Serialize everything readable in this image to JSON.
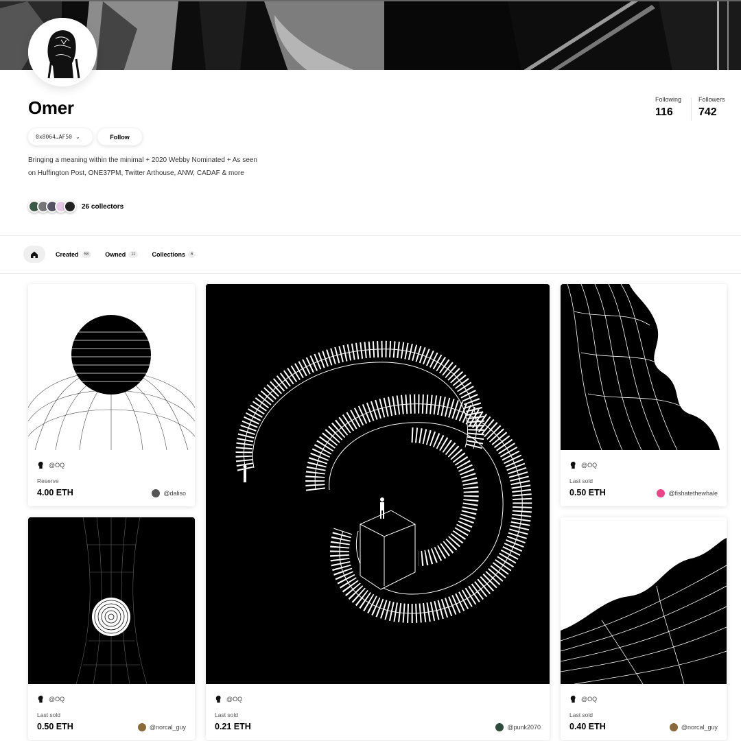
{
  "profile": {
    "name": "Omer",
    "address": "0x8064…AF50",
    "follow_label": "Follow",
    "bio": "Bringing a meaning within the minimal + 2020 Webby Nominated + As seen on Huffington Post, ONE37PM, Twitter Arthouse, ANW, CADAF & more",
    "collectors_label": "26 collectors"
  },
  "stats": {
    "following_label": "Following",
    "following_value": "116",
    "followers_label": "Followers",
    "followers_value": "742"
  },
  "tabs": [
    {
      "label": "Created",
      "count": "58"
    },
    {
      "label": "Owned",
      "count": "11"
    },
    {
      "label": "Collections",
      "count": "6"
    }
  ],
  "cards": [
    {
      "creator": "@OQ",
      "status": "Reserve",
      "price": "4.00 ETH",
      "buyer": "@daliso",
      "buyer_color": "#555555"
    },
    {
      "creator": "@OQ",
      "status": "Last sold",
      "price": "0.21 ETH",
      "buyer": "@punk2070",
      "buyer_color": "#2e4a3a"
    },
    {
      "creator": "@OQ",
      "status": "Last sold",
      "price": "0.50 ETH",
      "buyer": "@fishatethewhale",
      "buyer_color": "#e8458b"
    },
    {
      "creator": "@OQ",
      "status": "Last sold",
      "price": "0.50 ETH",
      "buyer": "@norcal_guy",
      "buyer_color": "#8a6a3a"
    },
    {
      "creator": "@OQ",
      "status": "Last sold",
      "price": "0.40 ETH",
      "buyer": "@norcal_guy",
      "buyer_color": "#8a6a3a"
    }
  ],
  "colors": {
    "accent": "#000000",
    "tab_bg": "#efefef",
    "fishatethewhale_avatar": "#e8458b"
  },
  "icons": [
    "home-icon",
    "chevron-down-icon"
  ]
}
